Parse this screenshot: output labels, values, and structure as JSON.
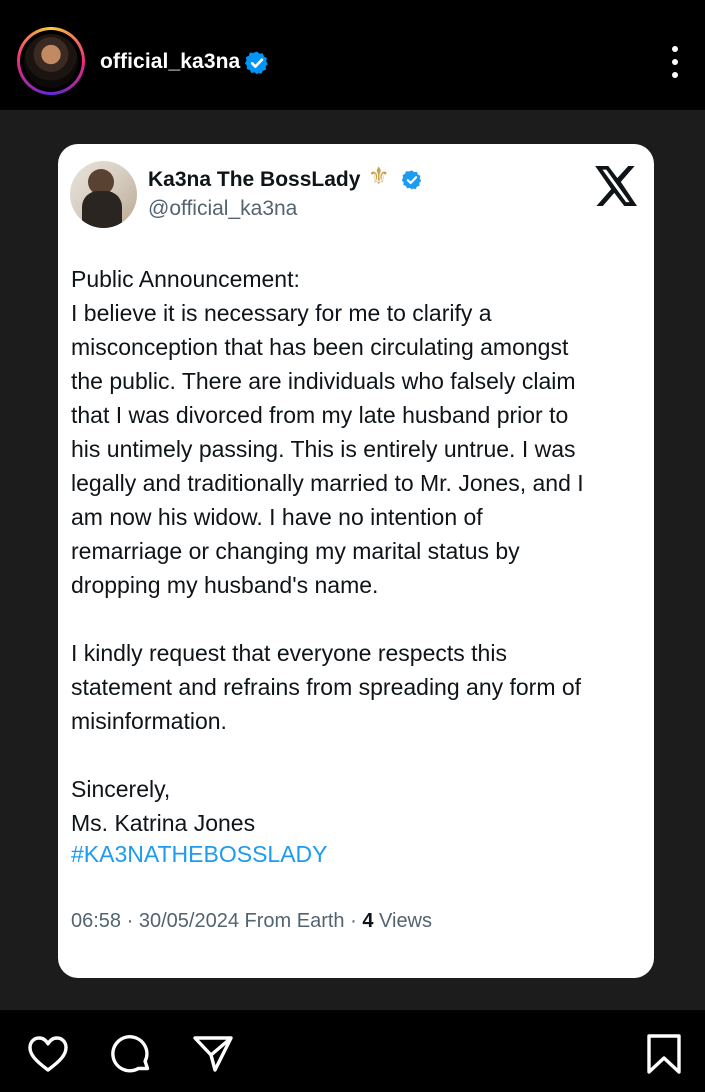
{
  "header": {
    "username": "official_ka3na",
    "verified_icon": "verified-badge-icon",
    "more_icon": "more-vertical-icon"
  },
  "tweet": {
    "display_name": "Ka3na The BossLady",
    "name_emoji": "⚜",
    "handle": "@official_ka3na",
    "platform_logo": "x-logo",
    "body": "Public Announcement:\nI believe it is necessary for me to clarify a\nmisconception that has been circulating amongst\nthe public. There are individuals who falsely claim\nthat I was divorced from my late husband prior to\nhis untimely passing. This is entirely untrue. I was\nlegally and traditionally married to Mr. Jones, and I\nam now his widow. I have no intention of\nremarriage or changing my marital status by\ndropping my husband's name.\n\nI kindly request that everyone respects this\nstatement and refrains from spreading any form of\nmisinformation.\n\nSincerely,\nMs. Katrina Jones",
    "hashtag": "#KA3NATHEBOSSLADY",
    "time": "06:58",
    "date": "30/05/2024",
    "source": "From Earth",
    "views_count": "4",
    "views_label": "Views"
  },
  "actions": {
    "like_icon": "heart-icon",
    "comment_icon": "comment-icon",
    "share_icon": "send-icon",
    "save_icon": "bookmark-icon"
  },
  "colors": {
    "verified": "#0095f6",
    "hashtag": "#1d9bf0",
    "muted_text": "#536471"
  }
}
